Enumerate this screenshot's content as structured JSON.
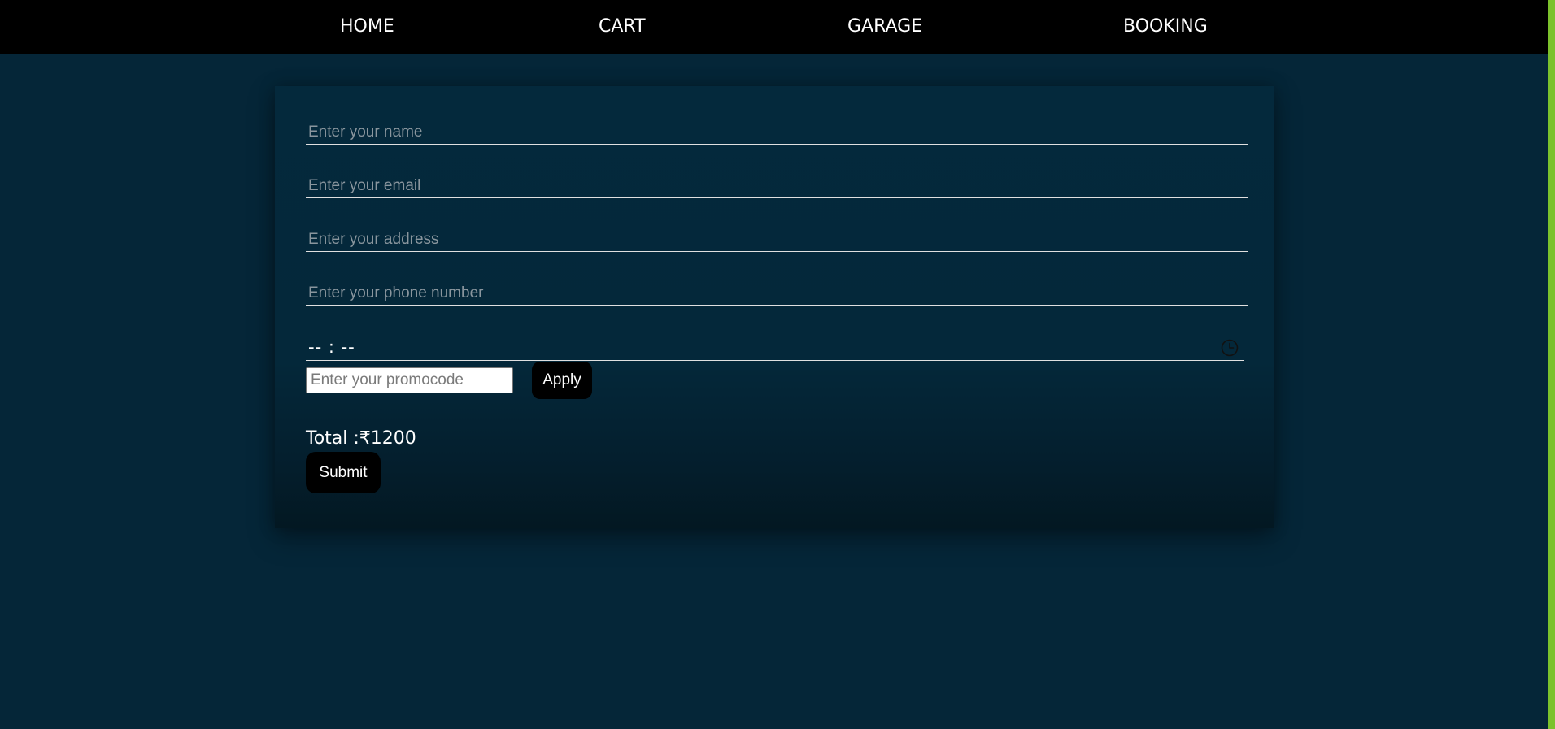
{
  "nav": {
    "items": [
      {
        "label": "HOME"
      },
      {
        "label": "CART"
      },
      {
        "label": "GARAGE"
      },
      {
        "label": "BOOKING"
      }
    ]
  },
  "form": {
    "name_placeholder": "Enter your name",
    "email_placeholder": "Enter your email",
    "address_placeholder": "Enter your address",
    "phone_placeholder": "Enter your phone number",
    "time_value": "-- : --",
    "promo_placeholder": "Enter your promocode",
    "apply_label": "Apply",
    "total_text": "Total :₹1200",
    "submit_label": "Submit"
  },
  "icons": {
    "time_picker": "clock-icon"
  },
  "colors": {
    "page_background": "#052638",
    "navbar_background": "#000000",
    "button_background": "#000000",
    "text": "#ffffff",
    "right_accent": "#7cc22c"
  }
}
